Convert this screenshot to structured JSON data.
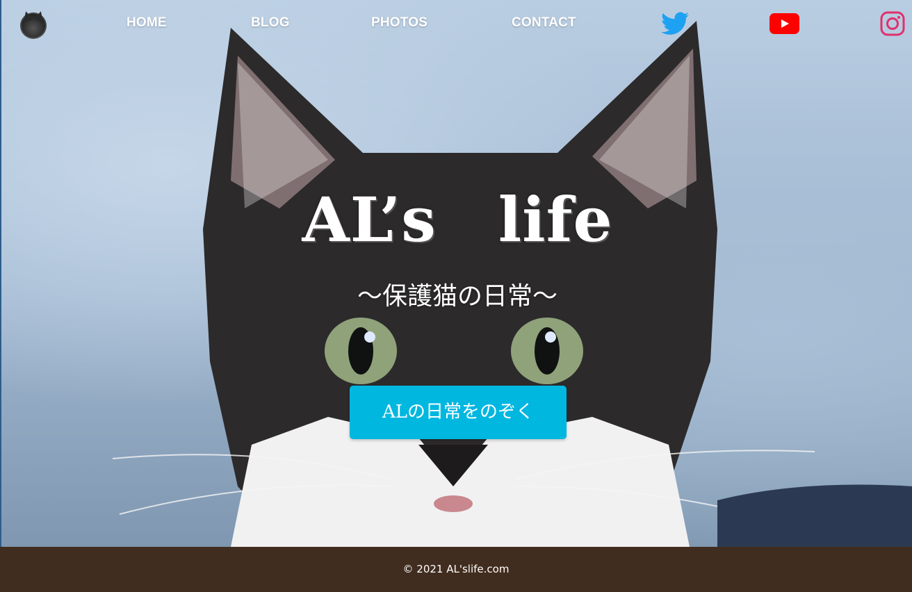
{
  "header": {
    "logo_icon": "cat-avatar-icon",
    "nav": [
      {
        "label": "HOME"
      },
      {
        "label": "BLOG"
      },
      {
        "label": "PHOTOS"
      },
      {
        "label": "CONTACT"
      }
    ],
    "social": [
      {
        "icon": "twitter-icon",
        "color": "#1da1f2"
      },
      {
        "icon": "youtube-icon",
        "color": "#ff0000"
      },
      {
        "icon": "instagram-icon",
        "color": "#e1306c"
      }
    ]
  },
  "hero": {
    "title": "AL’s　life",
    "subtitle": "～保護猫の日常～",
    "cta_label": "ALの日常をのぞく",
    "cta_color": "#00b7e0",
    "background": "cat-photo"
  },
  "footer": {
    "copyright": "© 2021 AL'slife.com",
    "color": "#412d1f"
  }
}
